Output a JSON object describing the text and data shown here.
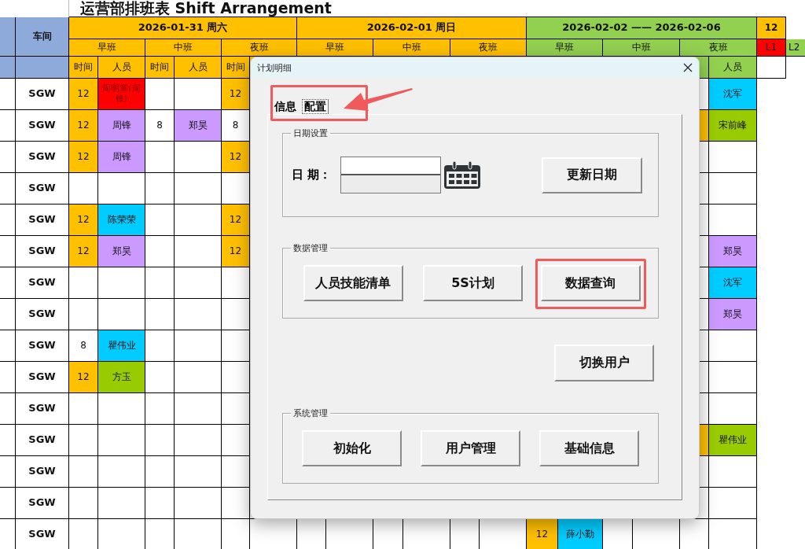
{
  "sheet": {
    "title": "运营部排班表 Shift Arrangement",
    "corner_label": "车间",
    "days": [
      {
        "label": "2026-01-31 周六",
        "color": "#ffc000"
      },
      {
        "label": "2026-02-01 周日",
        "color": "#ffc000"
      },
      {
        "label": "2026-02-02 —— 2026-02-06",
        "color": "#92d050"
      }
    ],
    "extra_top": {
      "label": "12",
      "color": "#ffc000"
    },
    "shifts": [
      "早班",
      "中班",
      "夜班",
      "早班",
      "中班",
      "夜班",
      "早班",
      "中班",
      "夜班"
    ],
    "extra_second": [
      {
        "label": "L1",
        "color": "#ff0000"
      },
      {
        "label": "L2",
        "color": "#92d050"
      }
    ],
    "subheads_left": [
      "时间",
      "人员",
      "时间",
      "人员",
      "时间"
    ],
    "subhead_right": "人员",
    "rows": [
      {
        "workshop": "SGW",
        "cells": [
          {
            "text": "12",
            "color": "#ffc000"
          },
          {
            "text": "周明章(周锋)",
            "color": "#ff0000"
          },
          {},
          {},
          {
            "text": "12",
            "color": "#ffc000"
          },
          {},
          {},
          {},
          {},
          {},
          {},
          {},
          {},
          {},
          {},
          {},
          {},
          {
            "text": "沈军",
            "color": "#00ccff"
          }
        ]
      },
      {
        "workshop": "SGW",
        "cells": [
          {
            "text": "12",
            "color": "#ffc000"
          },
          {
            "text": "周锋",
            "color": "#cc99ff"
          },
          {
            "text": "8"
          },
          {
            "text": "郑昊",
            "color": "#cc99ff"
          },
          {
            "text": "8"
          },
          {},
          {},
          {},
          {},
          {},
          {},
          {},
          {},
          {},
          {},
          {},
          {
            "color": "#ffc000"
          },
          {
            "text": "宋前峰",
            "color": "#99cc00"
          }
        ]
      },
      {
        "workshop": "SGW",
        "cells": [
          {
            "text": "12",
            "color": "#ffc000"
          },
          {
            "text": "周锋",
            "color": "#cc99ff"
          },
          {},
          {},
          {
            "text": "12",
            "color": "#ffc000"
          },
          {},
          {},
          {},
          {},
          {},
          {},
          {},
          {},
          {},
          {},
          {},
          {},
          {}
        ]
      },
      {
        "workshop": "SGW",
        "cells": [
          {},
          {},
          {},
          {},
          {},
          {},
          {},
          {},
          {},
          {},
          {},
          {},
          {},
          {},
          {},
          {},
          {},
          {}
        ]
      },
      {
        "workshop": "SGW",
        "cells": [
          {
            "text": "12",
            "color": "#ffc000"
          },
          {
            "text": "陈荣荣",
            "color": "#00ccff"
          },
          {},
          {},
          {
            "text": "12",
            "color": "#ffc000"
          },
          {},
          {},
          {},
          {},
          {},
          {},
          {},
          {},
          {},
          {},
          {},
          {},
          {}
        ]
      },
      {
        "workshop": "SGW",
        "cells": [
          {
            "text": "12",
            "color": "#ffc000"
          },
          {
            "text": "郑昊",
            "color": "#cc99ff"
          },
          {},
          {},
          {
            "text": "12",
            "color": "#ffc000"
          },
          {},
          {},
          {},
          {},
          {},
          {},
          {},
          {},
          {},
          {},
          {},
          {},
          {
            "text": "郑昊",
            "color": "#cc99ff"
          }
        ]
      },
      {
        "workshop": "SGW",
        "cells": [
          {},
          {},
          {},
          {},
          {},
          {},
          {},
          {},
          {},
          {},
          {},
          {},
          {},
          {},
          {},
          {},
          {},
          {
            "text": "沈军",
            "color": "#00ccff"
          }
        ]
      },
      {
        "workshop": "SGW",
        "cells": [
          {},
          {},
          {},
          {},
          {},
          {},
          {},
          {},
          {},
          {},
          {},
          {},
          {},
          {},
          {},
          {},
          {},
          {
            "text": "郑昊",
            "color": "#cc99ff"
          }
        ]
      },
      {
        "workshop": "SGW",
        "cells": [
          {
            "text": "8"
          },
          {
            "text": "瞿伟业",
            "color": "#00ccff"
          },
          {},
          {},
          {},
          {},
          {},
          {},
          {},
          {},
          {},
          {},
          {},
          {},
          {},
          {},
          {},
          {}
        ]
      },
      {
        "workshop": "SGW",
        "cells": [
          {
            "text": "12",
            "color": "#ffc000"
          },
          {
            "text": "方玉",
            "color": "#99cc00"
          },
          {},
          {},
          {},
          {},
          {},
          {},
          {},
          {},
          {},
          {},
          {},
          {},
          {},
          {},
          {},
          {}
        ]
      },
      {
        "workshop": "SGW",
        "cells": [
          {},
          {},
          {},
          {},
          {},
          {},
          {},
          {},
          {},
          {},
          {},
          {},
          {},
          {},
          {},
          {},
          {},
          {}
        ]
      },
      {
        "workshop": "SGW",
        "cells": [
          {},
          {},
          {},
          {},
          {},
          {},
          {},
          {},
          {},
          {},
          {},
          {},
          {},
          {},
          {},
          {},
          {
            "color": "#ffc000"
          },
          {
            "text": "瞿伟业",
            "color": "#99cc00"
          }
        ]
      },
      {
        "workshop": "SGW",
        "cells": [
          {},
          {},
          {},
          {},
          {},
          {},
          {},
          {},
          {},
          {},
          {},
          {},
          {},
          {},
          {},
          {},
          {},
          {}
        ]
      },
      {
        "workshop": "SGW",
        "cells": [
          {},
          {},
          {},
          {},
          {},
          {},
          {},
          {},
          {},
          {},
          {},
          {},
          {},
          {},
          {},
          {},
          {},
          {}
        ]
      },
      {
        "workshop": "SGW",
        "cells": [
          {},
          {},
          {},
          {},
          {},
          {},
          {},
          {},
          {},
          {},
          {},
          {},
          {
            "text": "12",
            "color": "#ffc000"
          },
          {
            "text": "薛小勤",
            "color": "#00ccff"
          },
          {},
          {},
          {},
          {}
        ]
      }
    ]
  },
  "dialog": {
    "title": "计划明细",
    "tabs_highlighted": true,
    "tabs": [
      {
        "label": "信息",
        "selected": false
      },
      {
        "label": "配置",
        "selected": true
      }
    ],
    "sections": [
      {
        "kind": "date",
        "title": "日期设置",
        "field_label": "日 期：",
        "button": {
          "label": "更新日期",
          "highlighted": false
        }
      },
      {
        "kind": "group",
        "title": "数据管理",
        "buttons": [
          {
            "label": "人员技能清单",
            "highlighted": false
          },
          {
            "label": "5S计划",
            "highlighted": false
          },
          {
            "label": "数据查询",
            "highlighted": true
          }
        ]
      },
      {
        "kind": "single",
        "button": {
          "label": "切换用户",
          "highlighted": false
        }
      },
      {
        "kind": "group",
        "title": "系统管理",
        "buttons": [
          {
            "label": "初始化",
            "highlighted": false
          },
          {
            "label": "用户管理",
            "highlighted": false
          },
          {
            "label": "基础信息",
            "highlighted": false
          }
        ]
      }
    ]
  }
}
